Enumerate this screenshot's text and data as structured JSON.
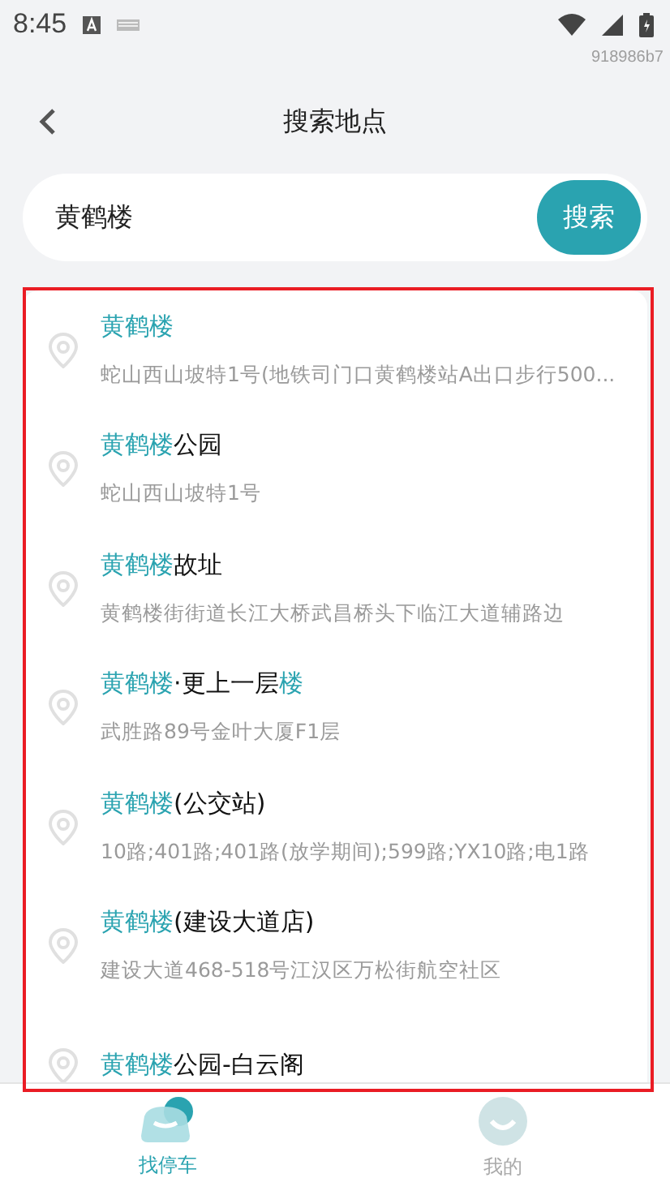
{
  "status_bar": {
    "time": "8:45"
  },
  "build_id": "918986b7",
  "header": {
    "title": "搜索地点"
  },
  "search": {
    "value": "黄鹤楼",
    "button": "搜索"
  },
  "results": [
    {
      "title": [
        {
          "text": "黄鹤楼",
          "highlight": true
        }
      ],
      "address": "蛇山西山坡特1号(地铁司门口黄鹤楼站A出口步行500..."
    },
    {
      "title": [
        {
          "text": "黄鹤楼",
          "highlight": true
        },
        {
          "text": "公园",
          "highlight": false
        }
      ],
      "address": "蛇山西山坡特1号"
    },
    {
      "title": [
        {
          "text": "黄鹤楼",
          "highlight": true
        },
        {
          "text": "故址",
          "highlight": false
        }
      ],
      "address": "黄鹤楼街街道长江大桥武昌桥头下临江大道辅路边"
    },
    {
      "title": [
        {
          "text": "黄鹤楼",
          "highlight": true
        },
        {
          "text": "·更上一层",
          "highlight": false
        },
        {
          "text": "楼",
          "highlight": true
        }
      ],
      "address": "武胜路89号金叶大厦F1层"
    },
    {
      "title": [
        {
          "text": "黄鹤楼",
          "highlight": true
        },
        {
          "text": "(公交站)",
          "highlight": false
        }
      ],
      "address": "10路;401路;401路(放学期间);599路;YX10路;电1路"
    },
    {
      "title": [
        {
          "text": "黄鹤楼",
          "highlight": true
        },
        {
          "text": "(建设大道店)",
          "highlight": false
        }
      ],
      "address": "建设大道468-518号江汉区万松街航空社区"
    },
    {
      "title": [
        {
          "text": "黄鹤楼",
          "highlight": true
        },
        {
          "text": "公园-白云阁",
          "highlight": false
        }
      ]
    }
  ],
  "tabs": [
    {
      "label": "找停车",
      "selected": true
    },
    {
      "label": "我的",
      "selected": false
    }
  ]
}
